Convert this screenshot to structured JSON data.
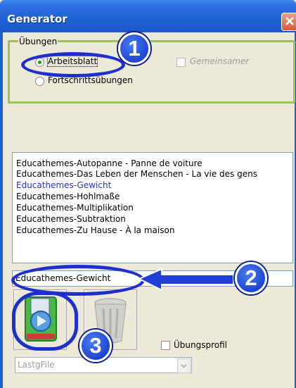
{
  "window": {
    "title": "Generator"
  },
  "exercises_group": {
    "legend": "Übungen",
    "option_worksheet": "Arbeitsblatt",
    "option_progress": "Fortschrittsübungen",
    "checkbox_shared": "Gemeinsamer"
  },
  "file_list": {
    "items": [
      "Educathemes-Autopanne  -  Panne de voiture",
      "Educathemes-Das Leben der Menschen  -  La vie des gens",
      "Educathemes-Gewicht",
      "Educathemes-Hohlmaße",
      "Educathemes-Multiplikation",
      "Educathemes-Subtraktion",
      "Educathemes-Zu Hause  -  À la maison"
    ],
    "selected_index": 2
  },
  "name_field": {
    "value": "Educathemes-Gewicht"
  },
  "profile_checkbox": {
    "label": "Übungsprofil"
  },
  "last_file_combo": {
    "value": "LastgFile"
  },
  "callouts": {
    "one": "1",
    "two": "2",
    "three": "3"
  },
  "colors": {
    "titlebar": "#1f5fd0",
    "group_border": "#9cc45a",
    "selected_text": "#2433c9",
    "callout": "#1f2fcf"
  }
}
